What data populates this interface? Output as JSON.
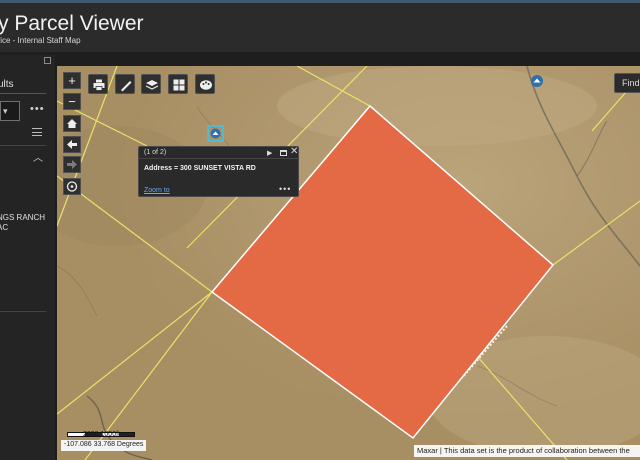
{
  "header": {
    "title": "y Parcel Viewer",
    "subtitle": "fice - Internal Staff Map"
  },
  "sidebar": {
    "tab_label": "ults",
    "select_arrow": "▾",
    "more_label": "•••",
    "collapse_chevron": "︿",
    "result_line1": "NGS RANCH",
    "result_line2": "AC"
  },
  "map_tools": {
    "zoom_in": "+",
    "zoom_out": "−",
    "home_icon": "home-icon",
    "back_icon": "arrow-left-icon",
    "forward_icon": "arrow-right-icon",
    "locate_icon": "locate-icon",
    "print_icon": "printer-icon",
    "measure_icon": "ruler-icon",
    "layers_icon": "layers-icon",
    "basemap_icon": "grid-icon",
    "legend_icon": "palette-icon"
  },
  "find": {
    "label": "Find"
  },
  "popup": {
    "counter": "(1 of 2)",
    "next": "▶",
    "close": "✕",
    "content": "Address = 300 SUNSET VISTA RD",
    "zoom_link": "Zoom to",
    "more": "•••"
  },
  "scale": {
    "text": "2000  1000ft"
  },
  "coords": {
    "text": "-107.086 33.768 Degrees"
  },
  "attribution": {
    "text": "Maxar | This data set is the product of collaboration between the"
  },
  "colors": {
    "parcel_fill": "#e46a45",
    "parcel_outline": "#ffffff",
    "parcel_lines": "#e8e26a",
    "accent": "#3f5a70",
    "link": "#6fa7e6"
  }
}
